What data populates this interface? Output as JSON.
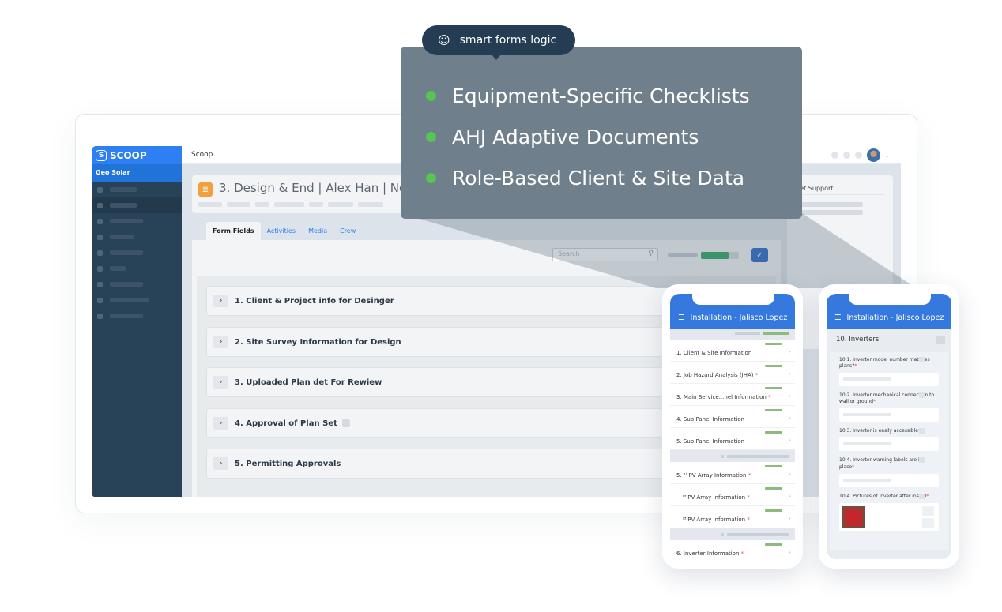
{
  "callout": {
    "badge_label": "smart forms logic",
    "badge_icon": "brain-head-icon",
    "bullets": [
      "Equipment-Specific Checklists",
      "AHJ Adaptive Documents",
      "Role-Based Client & Site Data"
    ],
    "bullet_color": "#56c554"
  },
  "app": {
    "logo": "SCOOP",
    "org": "Geo Solar",
    "topbar_title": "Scoop",
    "header_title": "3. Design & End | Alex Han | Nov 0",
    "tabs": [
      "Form Fields",
      "Activities",
      "Media",
      "Crew"
    ],
    "search_placeholder": "Search",
    "progress_fraction": 0.73,
    "sections": [
      "1. Client & Project info for Desinger",
      "2. Site Survey Information for Design",
      "3. Uploaded Plan det For Rewiew",
      "4. Approval of Plan Set",
      "5. Permitting Approvals"
    ],
    "right_panel_title": "Get Support",
    "accent": "#2d7ff3"
  },
  "phone1": {
    "title": "Installation - Jalisco Lopez",
    "rows": [
      {
        "label": "1. Client & Site Information",
        "required": false
      },
      {
        "label": "2. Job Hazard Analysis (JHA)",
        "required": true
      },
      {
        "label": "3. Main Service...nel Information",
        "required": true
      },
      {
        "label": "4. Sub Panel Information",
        "required": false
      },
      {
        "label": "5. Sub Panel Information",
        "required": false
      },
      {
        "label": "5. ¹⁾ PV Array Information",
        "required": true
      },
      {
        "label": "⁽²⁾PV Array Information",
        "required": true
      },
      {
        "label": "⁽³⁾PV Array Information",
        "required": true
      },
      {
        "label": "6. Inverter Information",
        "required": true
      }
    ]
  },
  "phone2": {
    "title": "Installation - Jalisco Lopez",
    "section_title": "10. Inverters",
    "questions": [
      {
        "label": "10.1. Inverter model number matches plans?",
        "required": true
      },
      {
        "label": "10.2. Inverter mechanical connection to wall or ground",
        "required": true
      },
      {
        "label": "10.3. Inverter is easily accessible",
        "required": true
      },
      {
        "label": "10.4. Inverter warning labels are in place",
        "required": true
      },
      {
        "label": "10.4. Pictures of inverter after install",
        "required": true
      }
    ]
  }
}
